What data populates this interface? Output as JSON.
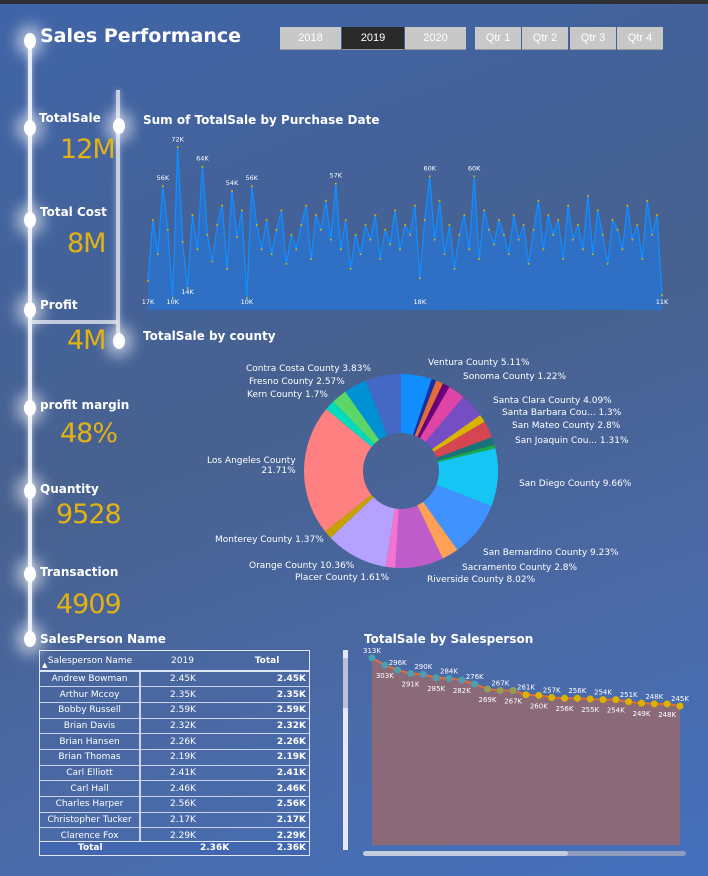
{
  "header": {
    "title": "Sales Performance"
  },
  "slicers": {
    "years": [
      "2018",
      "2019",
      "2020"
    ],
    "selected_year": "2019",
    "quarters": [
      "Qtr 1",
      "Qtr 2",
      "Qtr 3",
      "Qtr 4"
    ]
  },
  "kpis": [
    {
      "label": "TotalSale",
      "value": "12M"
    },
    {
      "label": "Total Cost",
      "value": "8M"
    },
    {
      "label": "Profit",
      "value": "4M"
    },
    {
      "label": "profit margin",
      "value": "48%"
    },
    {
      "label": "Quantity",
      "value": "9528"
    },
    {
      "label": "Transaction",
      "value": "4909"
    }
  ],
  "table": {
    "title": "SalesPerson Name",
    "columns": [
      "Salesperson Name",
      "2019",
      "Total"
    ],
    "rows": [
      [
        "Andrew Bowman",
        "2.45K",
        "2.45K"
      ],
      [
        "Arthur Mccoy",
        "2.35K",
        "2.35K"
      ],
      [
        "Bobby Russell",
        "2.59K",
        "2.59K"
      ],
      [
        "Brian Davis",
        "2.32K",
        "2.32K"
      ],
      [
        "Brian Hansen",
        "2.26K",
        "2.26K"
      ],
      [
        "Brian Thomas",
        "2.19K",
        "2.19K"
      ],
      [
        "Carl Elliott",
        "2.41K",
        "2.41K"
      ],
      [
        "Carl Hall",
        "2.46K",
        "2.46K"
      ],
      [
        "Charles Harper",
        "2.56K",
        "2.56K"
      ],
      [
        "Christopher Tucker",
        "2.17K",
        "2.17K"
      ],
      [
        "Clarence Fox",
        "2.29K",
        "2.29K"
      ]
    ],
    "total": [
      "Total",
      "2.36K",
      "2.36K"
    ]
  },
  "chart_data": [
    {
      "type": "line",
      "title": "Sum of TotalSale by Purchase Date",
      "line_color": "#118DFF",
      "marker_color": "#D9B300",
      "ylim": [
        5000,
        75000
      ],
      "values": [
        17,
        42,
        28,
        56,
        38,
        10,
        72,
        33,
        14,
        44,
        30,
        64,
        36,
        25,
        40,
        48,
        22,
        54,
        35,
        46,
        10,
        56,
        40,
        30,
        42,
        28,
        38,
        46,
        24,
        36,
        30,
        40,
        48,
        26,
        44,
        38,
        50,
        34,
        57,
        30,
        42,
        22,
        36,
        28,
        40,
        34,
        44,
        26,
        38,
        32,
        46,
        30,
        40,
        36,
        48,
        18,
        42,
        60,
        34,
        50,
        28,
        40,
        22,
        36,
        44,
        30,
        60,
        26,
        46,
        38,
        32,
        42,
        36,
        28,
        44,
        34,
        40,
        24,
        38,
        50,
        30,
        44,
        36,
        42,
        26,
        48,
        34,
        40,
        30,
        52,
        28,
        46,
        36,
        24,
        42,
        38,
        30,
        48,
        34,
        40,
        26,
        50,
        36,
        44,
        11
      ],
      "labels": [
        {
          "i": 0,
          "t": "17K"
        },
        {
          "i": 3,
          "t": "56K"
        },
        {
          "i": 5,
          "t": "10K"
        },
        {
          "i": 6,
          "t": "72K"
        },
        {
          "i": 8,
          "t": "14K"
        },
        {
          "i": 11,
          "t": "64K"
        },
        {
          "i": 17,
          "t": "54K"
        },
        {
          "i": 20,
          "t": "10K"
        },
        {
          "i": 21,
          "t": "56K"
        },
        {
          "i": 38,
          "t": "57K"
        },
        {
          "i": 55,
          "t": "18K"
        },
        {
          "i": 57,
          "t": "60K"
        },
        {
          "i": 66,
          "t": "60K"
        },
        {
          "i": 104,
          "t": "11K"
        }
      ]
    },
    {
      "type": "pie",
      "title": "TotalSale by county",
      "donut": true,
      "slices": [
        {
          "name": "Ventura County",
          "value": 5.11,
          "label": "Ventura County 5.11%",
          "color": "#118DFF"
        },
        {
          "name": "",
          "value": 0.8,
          "color": "#1A2FA0"
        },
        {
          "name": "",
          "value": 1.2,
          "color": "#E66C37"
        },
        {
          "name": "Sonoma County",
          "value": 1.22,
          "label": "Sonoma County 1.22%",
          "color": "#6B007B"
        },
        {
          "name": "",
          "value": 2.8,
          "color": "#E044A7"
        },
        {
          "name": "Santa Clara County",
          "value": 4.09,
          "label": "Santa Clara County 4.09%",
          "color": "#744EC2"
        },
        {
          "name": "Santa Barbara Cou...",
          "value": 1.3,
          "label": "Santa Barbara Cou... 1.3%",
          "color": "#D9B300"
        },
        {
          "name": "San Mateo County",
          "value": 2.8,
          "label": "San Mateo County 2.8%",
          "color": "#D64550"
        },
        {
          "name": "San Joaquin Cou...",
          "value": 1.31,
          "label": "San Joaquin Cou... 1.31%",
          "color": "#197278"
        },
        {
          "name": "",
          "value": 0.6,
          "color": "#1AAB40"
        },
        {
          "name": "San Diego County",
          "value": 9.66,
          "label": "San Diego County 9.66%",
          "color": "#15C6F4"
        },
        {
          "name": "San Bernardino County",
          "value": 9.23,
          "label": "San Bernardino County 9.23%",
          "color": "#4092FF"
        },
        {
          "name": "Sacramento County",
          "value": 2.8,
          "label": "Sacramento County 2.8%",
          "color": "#FFA058"
        },
        {
          "name": "Riverside County",
          "value": 8.02,
          "label": "Riverside County 8.02%",
          "color": "#BE5DC9"
        },
        {
          "name": "Placer County",
          "value": 1.61,
          "label": "Placer County 1.61%",
          "color": "#F472D0"
        },
        {
          "name": "Orange County",
          "value": 10.36,
          "label": "Orange County 10.36%",
          "color": "#B5A1FF"
        },
        {
          "name": "Monterey County",
          "value": 1.37,
          "label": "Monterey County 1.37%",
          "color": "#C4A200"
        },
        {
          "name": "Los Angeles County",
          "value": 21.71,
          "label": "Los Angeles County 21.71%",
          "color": "#FF8080"
        },
        {
          "name": "Kern County",
          "value": 1.7,
          "label": "Kern County 1.7%",
          "color": "#00DBBC"
        },
        {
          "name": "Fresno County",
          "value": 2.57,
          "label": "Fresno County 2.57%",
          "color": "#5BD667"
        },
        {
          "name": "Contra Costa County",
          "value": 3.83,
          "label": "Contra Costa County 3.83%",
          "color": "#0091D5"
        },
        {
          "name": "",
          "value": 5.9,
          "color": "#4668C5"
        }
      ]
    },
    {
      "type": "area",
      "title": "TotalSale by Salesperson",
      "fill_color": "#8a6a78",
      "line_color": "#E66C37",
      "values": [
        313,
        303,
        296,
        291,
        290,
        285,
        284,
        282,
        276,
        269,
        267,
        267,
        261,
        260,
        257,
        256,
        256,
        255,
        254,
        254,
        251,
        249,
        248,
        248,
        245
      ],
      "labels": [
        "313K",
        "303K",
        "296K",
        "291K",
        "290K",
        "285K",
        "284K",
        "282K",
        "276K",
        "269K",
        "267K",
        "267K",
        "261K",
        "260K",
        "257K",
        "256K",
        "256K",
        "255K",
        "254K",
        "254K",
        "251K",
        "249K",
        "248K",
        "248K",
        "245K"
      ]
    }
  ]
}
